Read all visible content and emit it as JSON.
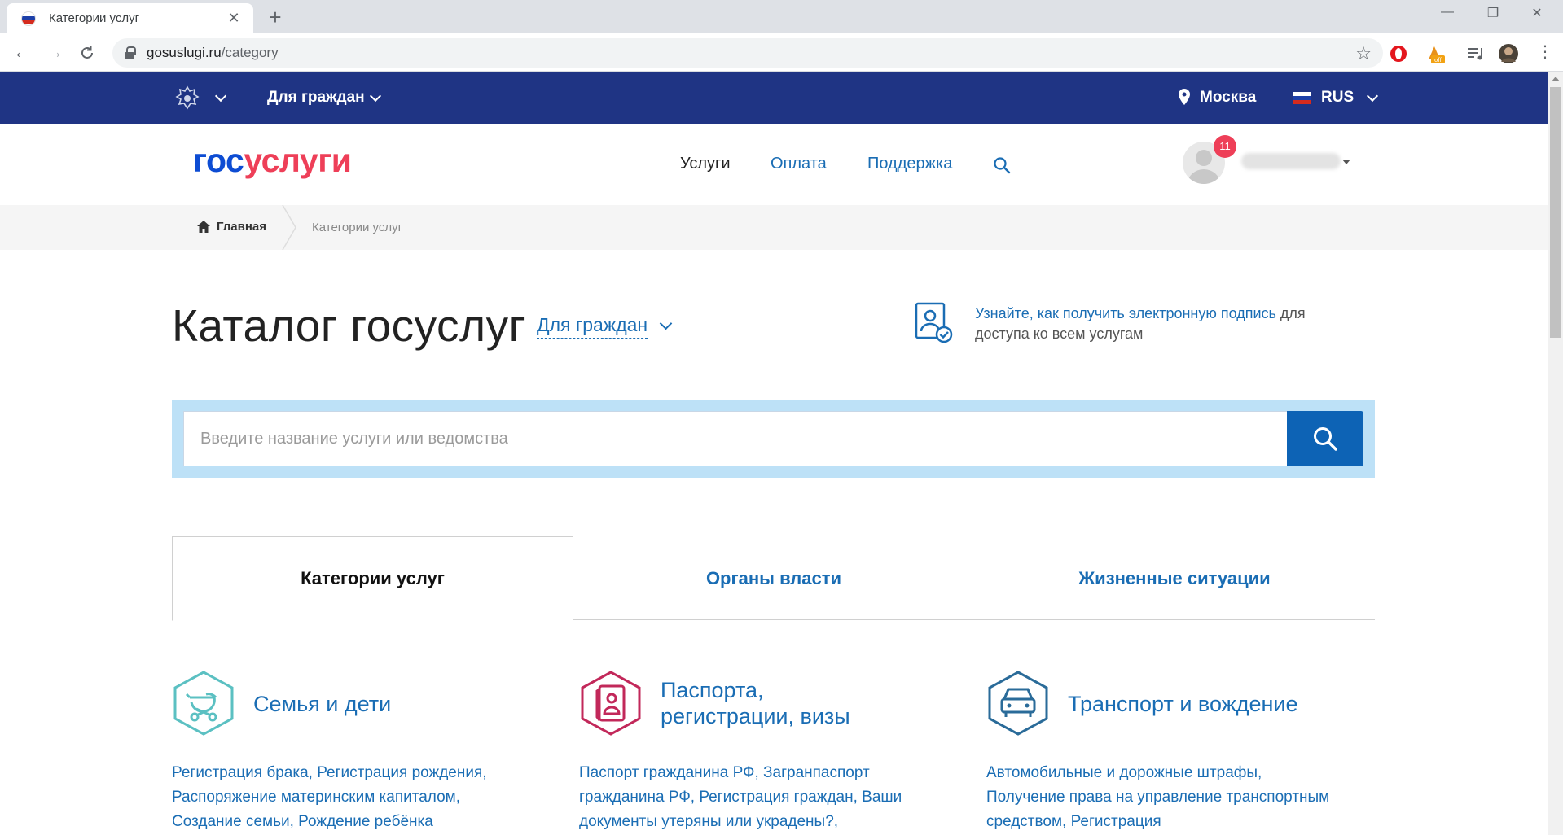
{
  "browser": {
    "tab_title": "Категории услуг",
    "url_host": "gosuslugi.ru",
    "url_path": "/category",
    "new_tab": "+",
    "close_tab": "✕"
  },
  "topbar": {
    "audience": "Для граждан",
    "city": "Москва",
    "language": "RUS"
  },
  "header": {
    "logo_part1": "гос",
    "logo_part2": "услуги",
    "nav": [
      "Услуги",
      "Оплата",
      "Поддержка"
    ],
    "notifications_count": "11"
  },
  "breadcrumb": {
    "home": "Главная",
    "current": "Категории услуг"
  },
  "catalog": {
    "title": "Каталог госуслуг",
    "filter": "Для граждан",
    "esign_link": "Узнайте, как получить электронную подпись",
    "esign_rest": " для доступа ко всем услугам"
  },
  "search": {
    "placeholder": "Введите название услуги или ведомства"
  },
  "tabs": [
    "Категории услуг",
    "Органы власти",
    "Жизненные ситуации"
  ],
  "categories": [
    {
      "name": "Семья и дети",
      "desc": "Регистрация брака, Регистрация рождения, Распоряжение материнским капиталом, Создание семьи, Рождение ребёнка",
      "icon": "stroller-icon",
      "color": "#5bc0c2"
    },
    {
      "name_line1": "Паспорта,",
      "name_line2": "регистрации, визы",
      "desc": "Паспорт гражданина РФ, Загранпаспорт гражданина РФ, Регистрация граждан, Ваши документы утеряны или украдены?,",
      "icon": "passport-icon",
      "color": "#c2285a"
    },
    {
      "name": "Транспорт и вождение",
      "desc": "Автомобильные и дорожные штрафы, Получение права на управление транспортным средством, Регистрация",
      "icon": "car-icon",
      "color": "#2a6b99"
    }
  ],
  "colors": {
    "topbar": "#1f3484",
    "link": "#1a6db4",
    "search_band": "#bde1f7",
    "search_button": "#0d63b5",
    "badge": "#ee3f58"
  }
}
